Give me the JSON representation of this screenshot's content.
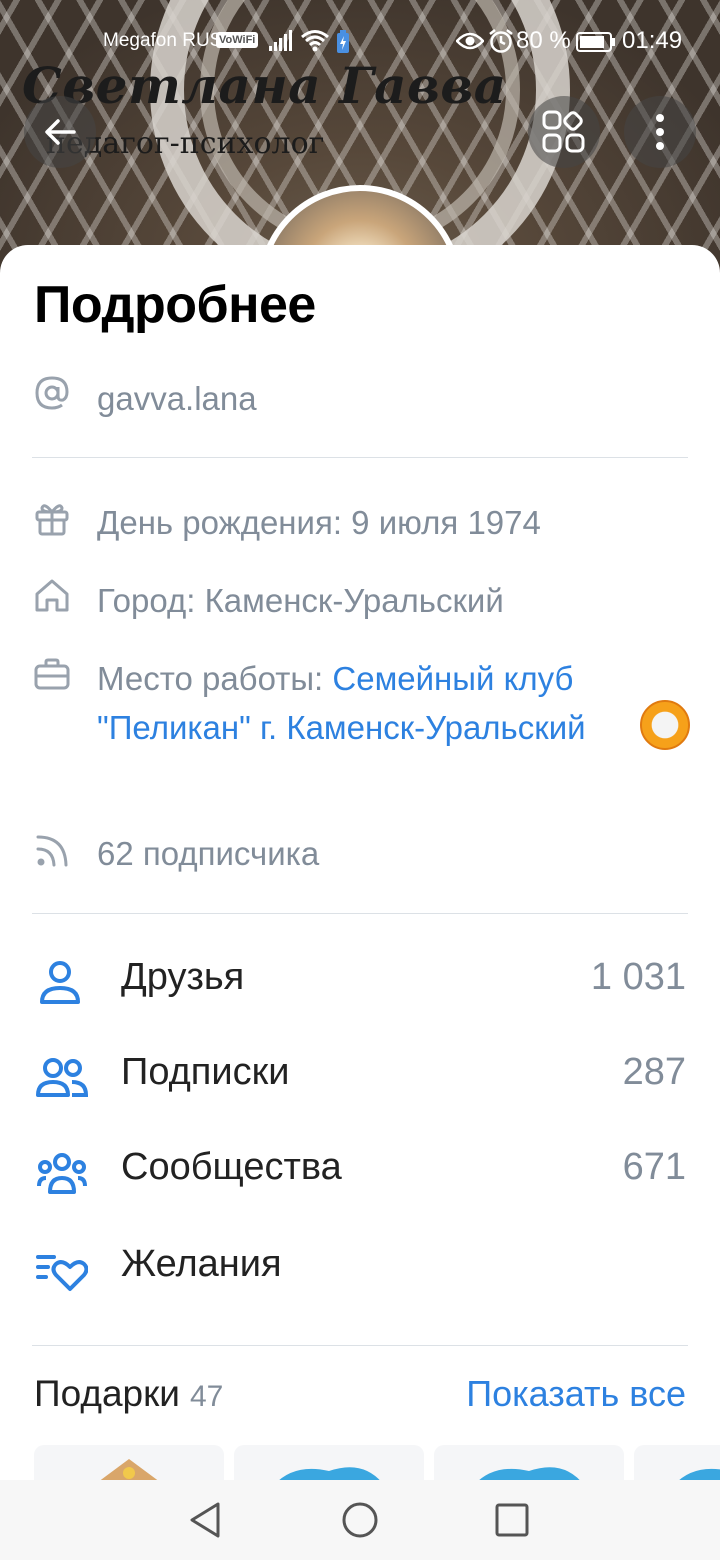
{
  "status_bar": {
    "operator": "Megafon RUS",
    "vowifi": "VoWiFi",
    "battery_percent": "80 %",
    "time": "01:49"
  },
  "cover": {
    "title": "Светлана Гавва",
    "subtitle": "педагог-психолог"
  },
  "sheet": {
    "title": "Подробнее",
    "username": "gavva.lana",
    "birthday": "День рождения: 9 июля 1974",
    "city": "Город: Каменск-Уральский",
    "work_prefix": "Место работы: ",
    "work_link": "Семейный клуб \"Пеликан\" г. Каменск-Уральский",
    "followers": "62 подписчика"
  },
  "stats": [
    {
      "label": "Друзья",
      "count": "1 031",
      "icon": "friend-icon"
    },
    {
      "label": "Подписки",
      "count": "287",
      "icon": "subscriptions-icon"
    },
    {
      "label": "Сообщества",
      "count": "671",
      "icon": "communities-icon"
    },
    {
      "label": "Желания",
      "count": "",
      "icon": "wishlist-icon"
    }
  ],
  "gifts": {
    "title": "Подарки",
    "count": "47",
    "show_all": "Показать все"
  },
  "colors": {
    "accent": "#2d81e0",
    "secondary_text": "#818c99",
    "divider": "#dce1e6"
  }
}
